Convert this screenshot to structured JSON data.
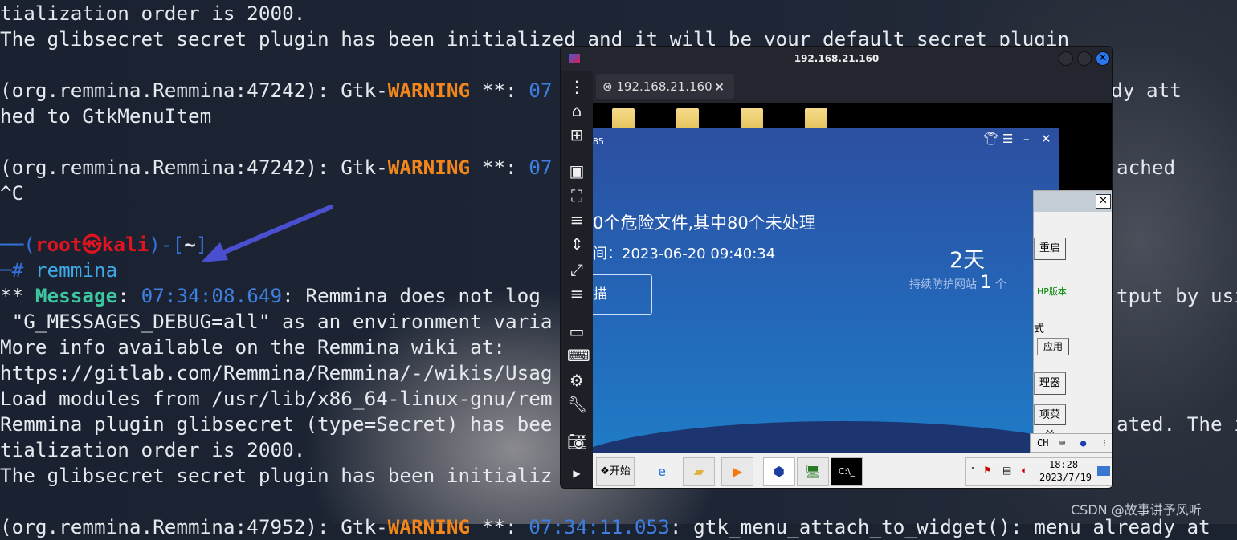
{
  "terminal": {
    "l1": "tialization order is 2000.",
    "l2": "The glibsecret secret plugin has been initialized and it will be your default secret plugin",
    "l4a": "(org.remmina.Remmina:47242): Gtk-",
    "warn": "WARNING",
    "l4b": " **: ",
    "ts07": "07",
    "l5": "hed to GtkMenuItem",
    "l8": "^C",
    "p_open": "──(",
    "p_user": "root㉿kali",
    "p_close": ")-[",
    "p_dir": "~",
    "p_end": "]",
    "p_hash": "─# ",
    "cmd": "remmina",
    "m_pre": "** ",
    "m_label": "Message",
    "m_colon": ": ",
    "m_ts": "07:34:08.649",
    "m_text": ": Remmina does not log",
    "l12": " \"G_MESSAGES_DEBUG=all\" as an environment varia",
    "l13": "More info available on the Remmina wiki at:",
    "l14": "https://gitlab.com/Remmina/Remmina/-/wikis/Usag",
    "l15": "Load modules from /usr/lib/x86_64-linux-gnu/rem",
    "l16": "Remmina plugin glibsecret (type=Secret) has bee",
    "l17": "tialization order is 2000.",
    "l18": "The glibsecret secret plugin has been initializ",
    "l20a": "(org.remmina.Remmina:47952): Gtk-",
    "l20b": " **: ",
    "l20ts": "07:34:11.053",
    "l20c": ": gtk_menu_attach_to_widget(): menu already at",
    "r4": "already att",
    "r7": "ached",
    "r11": "tput by usi",
    "r16": "ated. The i"
  },
  "remmina": {
    "title": "192.168.21.160",
    "tab_label": "192.168.21.160",
    "tab_close": "×",
    "toolbar": [
      "menu",
      "home",
      "new-connection",
      "fit-window",
      "fullscreen",
      "multi-monitor",
      "dynamic-resolution",
      "scale",
      "minimize",
      "keyboard",
      "preferences",
      "tools",
      "screenshot",
      "expand"
    ]
  },
  "remote": {
    "app": {
      "version_fragment": "85",
      "headline": "0个危险文件,其中80个未处理",
      "time_line": "间：2023-06-20 09:40:34",
      "scan_button": "描",
      "days": "2天",
      "protect_label": "持续防护网站",
      "protect_count": "1",
      "protect_unit": "个"
    },
    "dialog": {
      "close": "✕",
      "restart": "重启",
      "php_version": "HP版本",
      "mode": "式",
      "apply": "应用",
      "manager": "理器",
      "menu": "项菜单"
    },
    "langbar": {
      "lang": "CH"
    },
    "taskbar": {
      "start": "开始",
      "time": "18:28",
      "date": "2023/7/19"
    }
  },
  "watermark": "CSDN @故事讲予风听",
  "colors": {
    "warning": "#f2861a",
    "timestamp": "#3f7fe0",
    "message": "#3dc6a0",
    "prompt_user": "#e0141e",
    "arrow": "#4a4fd0"
  }
}
